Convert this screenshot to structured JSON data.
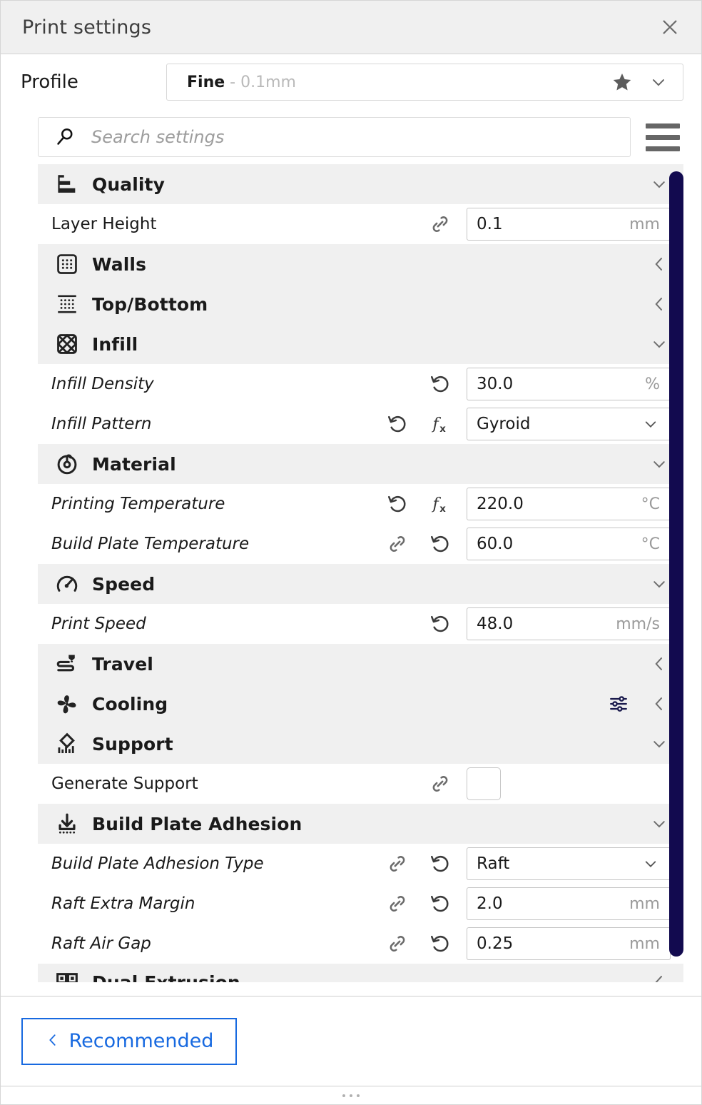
{
  "window": {
    "title": "Print settings",
    "close_icon": "close-icon"
  },
  "profile": {
    "label": "Profile",
    "name": "Fine",
    "detail": "- 0.1mm",
    "star_icon": "star-icon",
    "chevron_icon": "chevron-down-icon"
  },
  "search": {
    "placeholder": "Search settings",
    "value": "",
    "icon": "search-icon",
    "menu_icon": "hamburger-menu-icon"
  },
  "settings": [
    {
      "kind": "category",
      "name": "Quality",
      "icon": "quality-icon",
      "state": "expanded",
      "chevron": "chevron-down-icon"
    },
    {
      "kind": "setting",
      "name": "Layer Height",
      "modified": false,
      "icons": [
        "link-icon"
      ],
      "control": "text",
      "value": "0.1",
      "unit": "mm"
    },
    {
      "kind": "category",
      "name": "Walls",
      "icon": "walls-icon",
      "state": "collapsed",
      "chevron": "chevron-left-icon"
    },
    {
      "kind": "category",
      "name": "Top/Bottom",
      "icon": "top-bottom-icon",
      "state": "collapsed",
      "chevron": "chevron-left-icon"
    },
    {
      "kind": "category",
      "name": "Infill",
      "icon": "infill-icon",
      "state": "expanded",
      "chevron": "chevron-down-icon"
    },
    {
      "kind": "setting",
      "name": "Infill Density",
      "modified": true,
      "icons": [
        "revert-icon"
      ],
      "control": "text",
      "value": "30.0",
      "unit": "%"
    },
    {
      "kind": "setting",
      "name": "Infill Pattern",
      "modified": true,
      "icons": [
        "revert-icon",
        "formula-icon"
      ],
      "control": "dropdown",
      "value": "Gyroid",
      "unit": ""
    },
    {
      "kind": "category",
      "name": "Material",
      "icon": "material-icon",
      "state": "expanded",
      "chevron": "chevron-down-icon"
    },
    {
      "kind": "setting",
      "name": "Printing Temperature",
      "modified": true,
      "icons": [
        "revert-icon",
        "formula-icon"
      ],
      "control": "text",
      "value": "220.0",
      "unit": "°C"
    },
    {
      "kind": "setting",
      "name": "Build Plate Temperature",
      "modified": true,
      "icons": [
        "link-icon",
        "revert-icon"
      ],
      "control": "text",
      "value": "60.0",
      "unit": "°C"
    },
    {
      "kind": "category",
      "name": "Speed",
      "icon": "speed-icon",
      "state": "expanded",
      "chevron": "chevron-down-icon"
    },
    {
      "kind": "setting",
      "name": "Print Speed",
      "modified": true,
      "icons": [
        "revert-icon"
      ],
      "control": "text",
      "value": "48.0",
      "unit": "mm/s"
    },
    {
      "kind": "category",
      "name": "Travel",
      "icon": "travel-icon",
      "state": "collapsed",
      "chevron": "chevron-left-icon"
    },
    {
      "kind": "category",
      "name": "Cooling",
      "icon": "cooling-icon",
      "state": "collapsed",
      "chevron": "chevron-left-icon",
      "badge": "settings-sliders-icon"
    },
    {
      "kind": "category",
      "name": "Support",
      "icon": "support-icon",
      "state": "expanded",
      "chevron": "chevron-down-icon"
    },
    {
      "kind": "setting",
      "name": "Generate Support",
      "modified": false,
      "icons": [
        "link-icon"
      ],
      "control": "checkbox",
      "value": "",
      "checked": false,
      "unit": ""
    },
    {
      "kind": "category",
      "name": "Build Plate Adhesion",
      "icon": "build-plate-adhesion-icon",
      "state": "expanded",
      "chevron": "chevron-down-icon"
    },
    {
      "kind": "setting",
      "name": "Build Plate Adhesion Type",
      "modified": true,
      "icons": [
        "link-icon",
        "revert-icon"
      ],
      "control": "dropdown",
      "value": "Raft",
      "unit": ""
    },
    {
      "kind": "setting",
      "name": "Raft Extra Margin",
      "modified": true,
      "icons": [
        "link-icon",
        "revert-icon"
      ],
      "control": "text",
      "value": "2.0",
      "unit": "mm"
    },
    {
      "kind": "setting",
      "name": "Raft Air Gap",
      "modified": true,
      "icons": [
        "link-icon",
        "revert-icon"
      ],
      "control": "text",
      "value": "0.25",
      "unit": "mm"
    },
    {
      "kind": "category",
      "name": "Dual Extrusion",
      "icon": "dual-extrusion-icon",
      "state": "collapsed",
      "chevron": "chevron-left-icon",
      "clipped": true
    }
  ],
  "footer": {
    "recommended_label": "Recommended",
    "back_icon": "chevron-left-icon"
  },
  "colors": {
    "accent_blue": "#1769e0",
    "scrollbar_navy": "#120a4f",
    "category_bg": "#f0f0f0",
    "titlebar_bg": "#f0f0f0"
  }
}
